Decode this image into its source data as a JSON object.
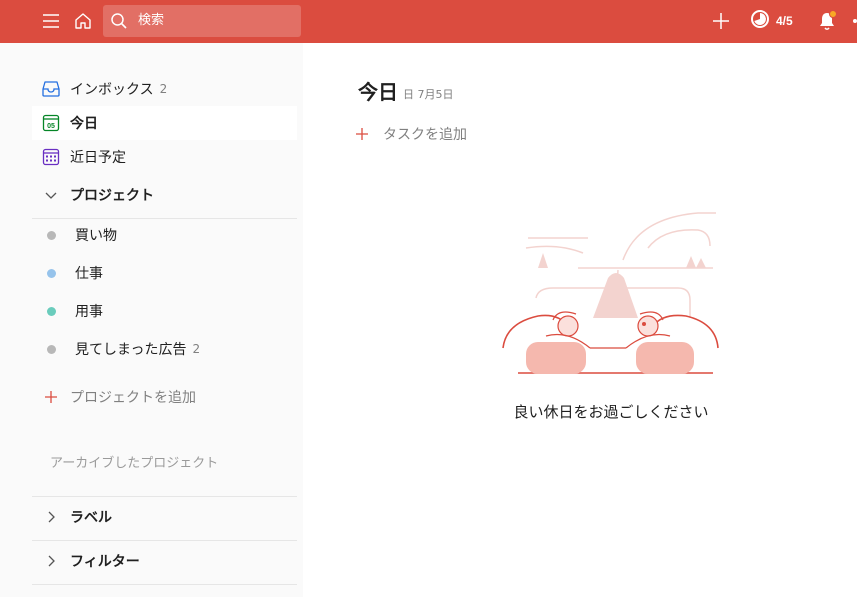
{
  "topbar": {
    "search_placeholder": "検索",
    "karma_progress": "4/5",
    "notification_badge": true,
    "colors": {
      "bar": "#db4c3f",
      "badge": "#f9a825"
    }
  },
  "sidebar": {
    "inbox": {
      "label": "インボックス",
      "count": "2",
      "icon": "inbox-icon"
    },
    "today": {
      "label": "今日",
      "icon_text": "05",
      "icon": "calendar-today-icon"
    },
    "upcoming": {
      "label": "近日予定",
      "icon": "calendar-grid-icon"
    },
    "projects_header": "プロジェクト",
    "projects": [
      {
        "label": "買い物",
        "count": "",
        "color": "#b8b8b8"
      },
      {
        "label": "仕事",
        "count": "",
        "color": "#96c3eb"
      },
      {
        "label": "用事",
        "count": "",
        "color": "#6accbc"
      },
      {
        "label": "見てしまった広告",
        "count": "2",
        "color": "#b8b8b8"
      }
    ],
    "add_project": "プロジェクトを追加",
    "archived": "アーカイブしたプロジェクト",
    "labels_header": "ラベル",
    "filters_header": "フィルター"
  },
  "main": {
    "title": "今日",
    "subtitle": "日 7月5日",
    "add_task": "タスクを追加",
    "empty_message": "良い休日をお過ごしください",
    "accent_color": "#db4c3f"
  }
}
